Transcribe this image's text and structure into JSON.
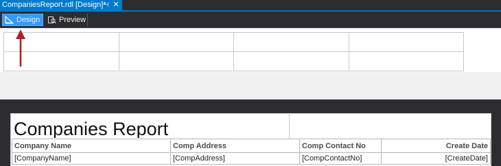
{
  "document_tab": {
    "title": "CompaniesReport.rdl [Design]*",
    "pin_glyph": "⊣",
    "close_glyph": "✕"
  },
  "toolbar": {
    "design_label": "Design",
    "preview_label": "Preview",
    "active": "Design"
  },
  "design_surface": {
    "tablix_rows": 2,
    "tablix_columns": 4
  },
  "annotation": {
    "arrow_color": "#b41e1e"
  },
  "report": {
    "title": "Companies Report",
    "columns": [
      {
        "header": "Company Name",
        "field": "[CompanyName]",
        "align": "left"
      },
      {
        "header": "Comp Address",
        "field": "[CompAddress]",
        "align": "left"
      },
      {
        "header": "Comp Contact No",
        "field": "[CompContactNo]",
        "align": "left"
      },
      {
        "header": "Create Date",
        "field": "[CreateDate]",
        "align": "right"
      }
    ]
  },
  "colors": {
    "accent": "#007acc",
    "active_button": "#3399ff",
    "chrome_dark": "#2d2d30"
  }
}
